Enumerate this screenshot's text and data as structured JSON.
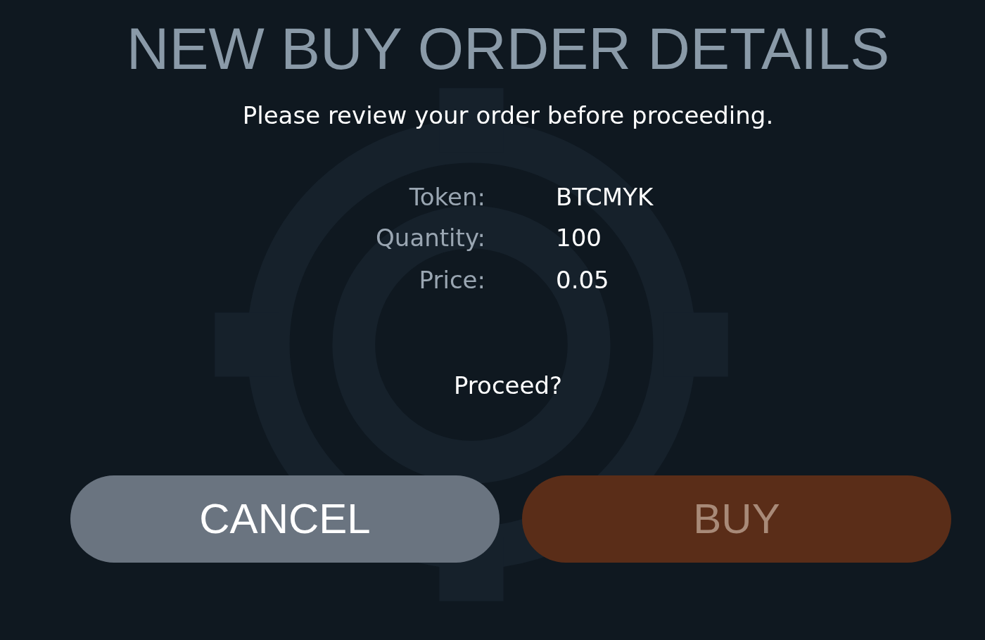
{
  "title": "NEW BUY ORDER DETAILS",
  "subtitle": "Please review your order before proceeding.",
  "details": [
    {
      "label": "Token:",
      "value": "BTCMYK"
    },
    {
      "label": "Quantity:",
      "value": "100"
    },
    {
      "label": "Price:",
      "value": "0.05"
    }
  ],
  "prompt": "Proceed?",
  "buttons": [
    {
      "label": "CANCEL",
      "kind": "cancel"
    },
    {
      "label": "BUY",
      "kind": "buy"
    }
  ]
}
